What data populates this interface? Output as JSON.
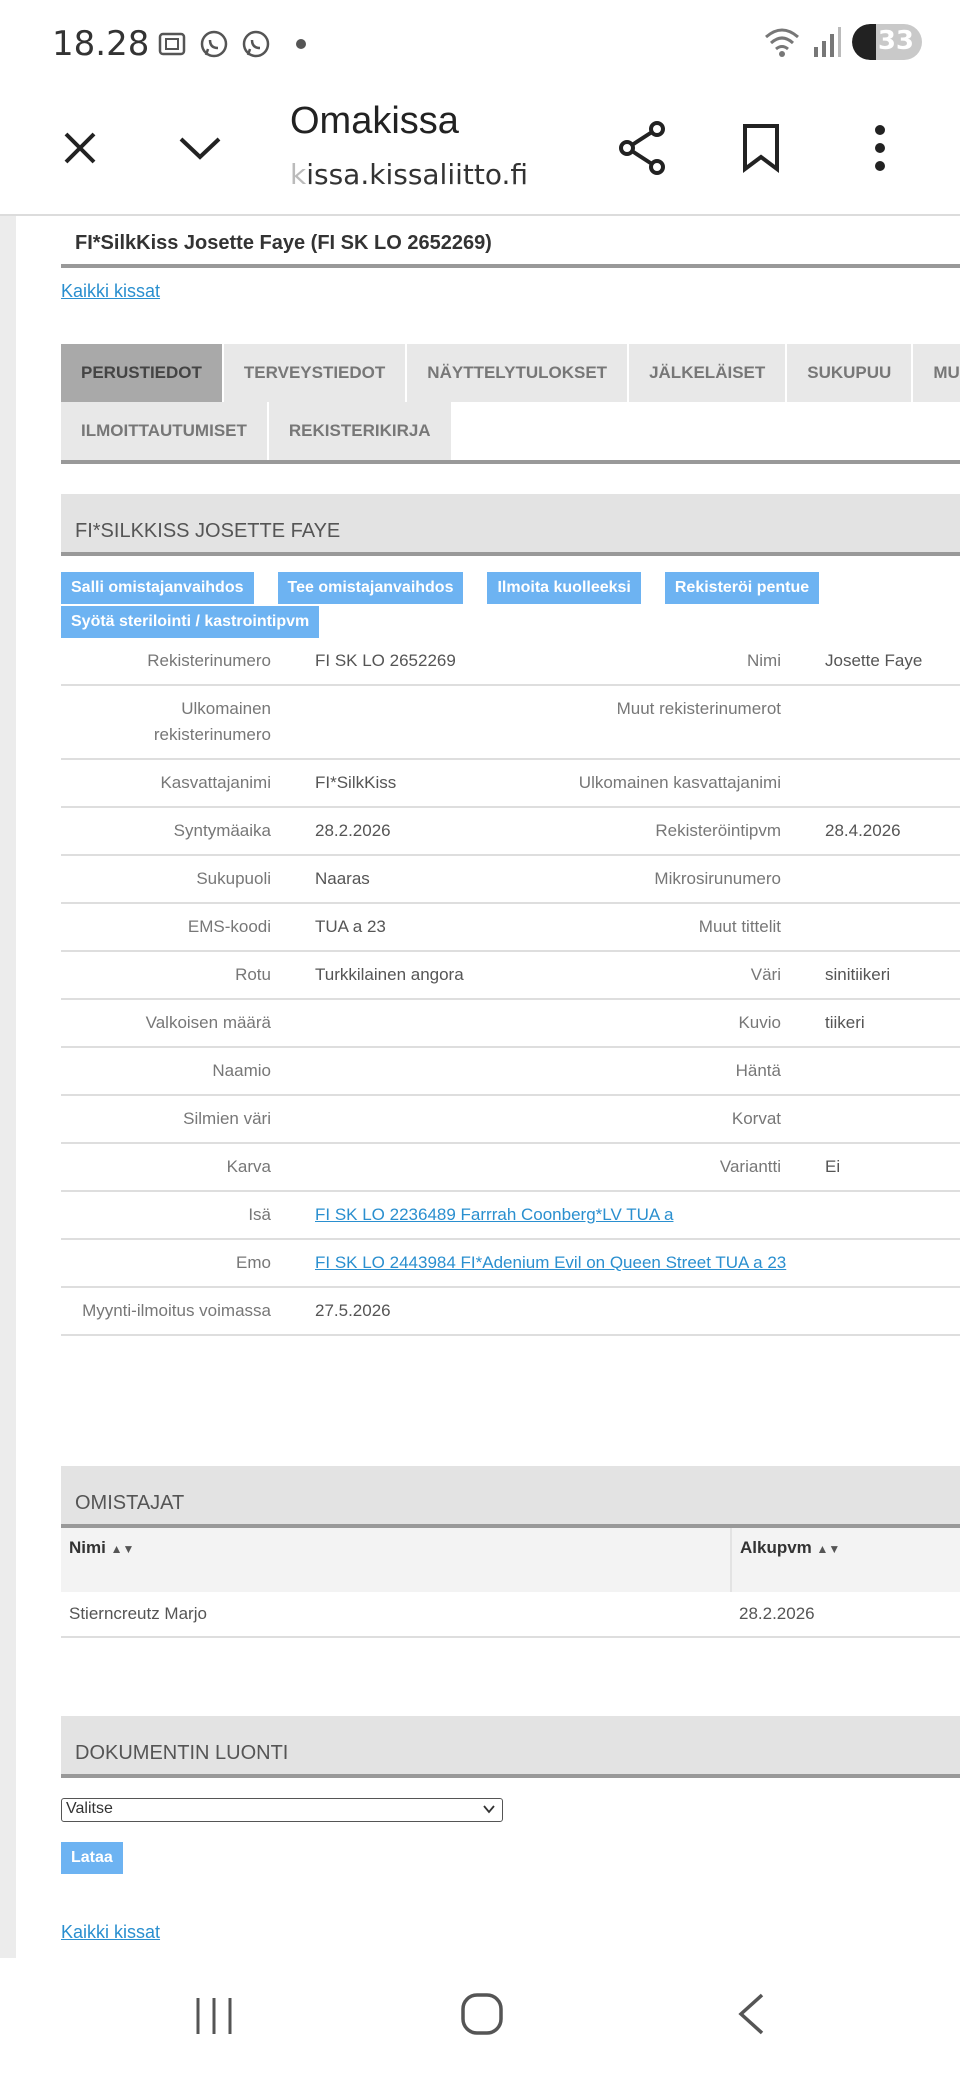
{
  "status_bar": {
    "time": "18.28",
    "battery": "33",
    "left_icons": [
      "screenshot-icon",
      "whatsapp-icon",
      "whatsapp-icon",
      "dot-icon"
    ],
    "right_icons": [
      "wifi-icon",
      "signal-icon",
      "battery-icon"
    ]
  },
  "browser": {
    "title": "Omakissa",
    "url_fade": "k",
    "url_rest": "issa.kissaliitto.fi"
  },
  "page": {
    "cat_title": "FI*SilkKiss Josette Faye (FI SK LO 2652269)",
    "all_cats_link": "Kaikki kissat",
    "tabs_row1": [
      "PERUSTIEDOT",
      "TERVEYSTIEDOT",
      "NÄYTTELYTULOKSET",
      "JÄLKELÄISET",
      "SUKUPUU",
      "MUUTO"
    ],
    "tabs_row2": [
      "ILMOITTAUTUMISET",
      "REKISTERIKIRJA"
    ],
    "section_title": "FI*SILKKISS JOSETTE FAYE",
    "actions": [
      "Salli omistajanvaihdos",
      "Tee omistajanvaihdos",
      "Ilmoita kuolleeksi",
      "Rekisteröi pentue",
      "Syötä sterilointi / kastrointipvm"
    ],
    "info": [
      {
        "l1": "Rekisterinumero",
        "v1": "FI SK LO 2652269",
        "l2": "Nimi",
        "v2": "Josette Faye"
      },
      {
        "l1": "Ulkomainen rekisterinumero",
        "v1": "",
        "l2": "Muut rekisterinumerot",
        "v2": ""
      },
      {
        "l1": "Kasvattajanimi",
        "v1": "FI*SilkKiss",
        "l2": "Ulkomainen kasvattajanimi",
        "v2": ""
      },
      {
        "l1": "Syntymäaika",
        "v1": "28.2.2026",
        "l2": "Rekisteröintipvm",
        "v2": "28.4.2026"
      },
      {
        "l1": "Sukupuoli",
        "v1": "Naaras",
        "l2": "Mikrosirunumero",
        "v2": ""
      },
      {
        "l1": "EMS-koodi",
        "v1": "TUA a 23",
        "l2": "Muut tittelit",
        "v2": ""
      },
      {
        "l1": "Rotu",
        "v1": "Turkkilainen angora",
        "l2": "Väri",
        "v2": "sinitiikeri"
      },
      {
        "l1": "Valkoisen määrä",
        "v1": "",
        "l2": "Kuvio",
        "v2": "tiikeri"
      },
      {
        "l1": "Naamio",
        "v1": "",
        "l2": "Häntä",
        "v2": ""
      },
      {
        "l1": "Silmien väri",
        "v1": "",
        "l2": "Korvat",
        "v2": ""
      },
      {
        "l1": "Karva",
        "v1": "",
        "l2": "Variantti",
        "v2": "Ei"
      }
    ],
    "father_label": "Isä",
    "father_link": "FI SK LO 2236489 Farrrah Coonberg*LV TUA a",
    "mother_label": "Emo",
    "mother_link": "FI SK LO 2443984 FI*Adenium Evil on Queen Street TUA a 23",
    "sale_label": "Myynti-ilmoitus voimassa",
    "sale_value": "27.5.2026",
    "owners_title": "OMISTAJAT",
    "owners_col_name": "Nimi",
    "owners_col_start": "Alkupvm",
    "owner_name": "Stierncreutz Marjo",
    "owner_start": "28.2.2026",
    "doc_title": "DOKUMENTIN LUONTI",
    "select_value": "Valitse",
    "load_button": "Lataa"
  },
  "nav_bar": {
    "icons": [
      "recent-apps-icon",
      "home-icon",
      "back-icon"
    ]
  },
  "colors": {
    "link": "#2a8fcf",
    "button": "#6db3f2",
    "tab_active": "#a9a9a9",
    "tab": "#e8e8e8"
  }
}
